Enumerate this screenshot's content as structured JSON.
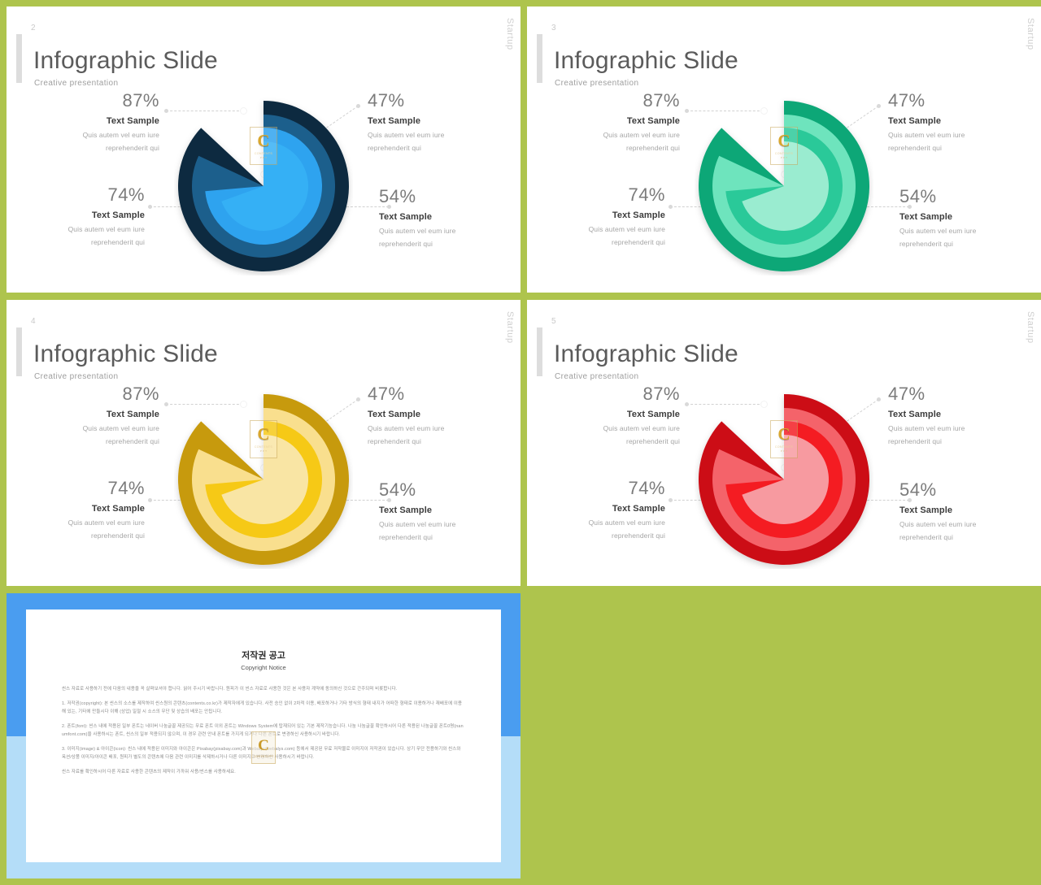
{
  "background_color": "#aec44d",
  "slides": [
    {
      "number": "2",
      "title": "Infographic Slide",
      "subtitle": "Creative  presentation",
      "brand": "Startup",
      "theme": "blue",
      "colors": {
        "ring_outer": "#0e2b40",
        "ring_mid": "#1d5e8c",
        "ring_inner": "#2fa3ef",
        "core": "#35b0f5"
      },
      "labels": [
        {
          "pos": "top-left",
          "percent": "87%",
          "title": "Text Sample",
          "body_line1": "Quis autem  vel eum  iure",
          "body_line2": "reprehenderit   qui"
        },
        {
          "pos": "top-right",
          "percent": "47%",
          "title": "Text Sample",
          "body_line1": "Quis autem  vel eum  iure",
          "body_line2": "reprehenderit   qui"
        },
        {
          "pos": "bottom-left",
          "percent": "74%",
          "title": "Text Sample",
          "body_line1": "Quis autem  vel eum  iure",
          "body_line2": "reprehenderit   qui"
        },
        {
          "pos": "bottom-right",
          "percent": "54%",
          "title": "Text Sample",
          "body_line1": "Quis autem  vel eum  iure",
          "body_line2": "reprehenderit   qui"
        }
      ]
    },
    {
      "number": "3",
      "title": "Infographic Slide",
      "subtitle": "Creative  presentation",
      "brand": "Startup",
      "theme": "green",
      "colors": {
        "ring_outer": "#0fa777",
        "ring_mid": "#6ee4bd",
        "ring_inner": "#2cc999",
        "core": "#9aecd0"
      },
      "labels": [
        {
          "pos": "top-left",
          "percent": "87%",
          "title": "Text Sample",
          "body_line1": "Quis autem  vel eum  iure",
          "body_line2": "reprehenderit   qui"
        },
        {
          "pos": "top-right",
          "percent": "47%",
          "title": "Text Sample",
          "body_line1": "Quis autem  vel eum  iure",
          "body_line2": "reprehenderit   qui"
        },
        {
          "pos": "bottom-left",
          "percent": "74%",
          "title": "Text Sample",
          "body_line1": "Quis autem  vel eum  iure",
          "body_line2": "reprehenderit   qui"
        },
        {
          "pos": "bottom-right",
          "percent": "54%",
          "title": "Text Sample",
          "body_line1": "Quis autem  vel eum  iure",
          "body_line2": "reprehenderit   qui"
        }
      ]
    },
    {
      "number": "4",
      "title": "Infographic Slide",
      "subtitle": "Creative  presentation",
      "brand": "Startup",
      "theme": "gold",
      "colors": {
        "ring_outer": "#c79a10",
        "ring_mid": "#f9df8e",
        "ring_inner": "#f6c913",
        "core": "#f9e5a4"
      },
      "labels": [
        {
          "pos": "top-left",
          "percent": "87%",
          "title": "Text Sample",
          "body_line1": "Quis autem  vel eum  iure",
          "body_line2": "reprehenderit   qui"
        },
        {
          "pos": "top-right",
          "percent": "47%",
          "title": "Text Sample",
          "body_line1": "Quis autem  vel eum  iure",
          "body_line2": "reprehenderit   qui"
        },
        {
          "pos": "bottom-left",
          "percent": "74%",
          "title": "Text Sample",
          "body_line1": "Quis autem  vel eum  iure",
          "body_line2": "reprehenderit   qui"
        },
        {
          "pos": "bottom-right",
          "percent": "54%",
          "title": "Text Sample",
          "body_line1": "Quis autem  vel eum  iure",
          "body_line2": "reprehenderit   qui"
        }
      ]
    },
    {
      "number": "5",
      "title": "Infographic Slide",
      "subtitle": "Creative  presentation",
      "brand": "Startup",
      "theme": "red",
      "colors": {
        "ring_outer": "#cc0b15",
        "ring_mid": "#f4636b",
        "ring_inner": "#f41a23",
        "core": "#f79aa0"
      },
      "labels": [
        {
          "pos": "top-left",
          "percent": "87%",
          "title": "Text Sample",
          "body_line1": "Quis autem  vel eum  iure",
          "body_line2": "reprehenderit   qui"
        },
        {
          "pos": "top-right",
          "percent": "47%",
          "title": "Text Sample",
          "body_line1": "Quis autem  vel eum  iure",
          "body_line2": "reprehenderit   qui"
        },
        {
          "pos": "bottom-left",
          "percent": "74%",
          "title": "Text Sample",
          "body_line1": "Quis autem  vel eum  iure",
          "body_line2": "reprehenderit   qui"
        },
        {
          "pos": "bottom-right",
          "percent": "54%",
          "title": "Text Sample",
          "body_line1": "Quis autem  vel eum  iure",
          "body_line2": "reprehenderit   qui"
        }
      ]
    }
  ],
  "watermark": {
    "letter": "C",
    "line1": "CONTENTS",
    "line2": "P P T"
  },
  "copyright_panel": {
    "frame_top_color": "#4a9df0",
    "frame_bottom_color": "#b4ddf8",
    "title": "저작권 공고",
    "subtitle": "Copyright Notice",
    "paragraphs": [
      "씬스 자료로 사용하기 전에 다음의 내용을 꼭 살펴보셔야 합니다. 읽어 주시기 바랍니다. 원피가 이 씬스 자료로 사용한 것은 본 사용자 계약에 동의하신 것으로 간주되며 비롯합니다.",
      "1. 저작권(copyright): 본 씬스의 소스를 제작하여 씬스원의 콘텐츠(contents.co.kr)가 제작자에게 있습니다. 사전 승인 없이 2차적 이용, 배포하거나 기타 방식의 형태 내지가 어떠한 형태로 이용하거나 재배포에 이용해 있는, 기타에 만들시다 이해 (상업) 일절 시 소스의 무단 및 상습의 배포는 안됩니다.",
      "2. 폰트(font): 씬스 내에 적용된 일부 폰트는 네이버 나눔글꼴 제공되는 무료 폰트 이외 폰트는 Windows System에 탑재되어 있는 기본 제작기능습니다. 나눔 나눔글꼴 확인하시어 다른 적용된 나눔글꼴 폰트0명(nanumfont.com)을 사용하시는 폰트, 씬스의 일부 적용되지 않으며, 이 경우 관련 안내 폰트를 가지게 되거나 다른 폰트로 변경하신 사용하시기 바랍니다.",
      "3. 이미지(image) & 아이콘(icon): 씬스 내에 적용된 이미지와 아이콘은 Pixabay(pixabay.com)과 Webalys(webalys.com) 등에서 제공된 무료 저작물로 이미지이 저작권이 있습니다. 상기 무단 전용하기와 씬스와 옥션/상품 이미지/아이콘 배포, 원피가 별도의 콘텐츠에 다음 관련 이미지를 삭제하시거나 다른 이미지로 변경하신 사용하시기 바랍니다.",
      "씬스 자료를 확인하시어 다른 자료로 사용한 콘텐츠의 제작이 가까워 사용/씬스를 사용하세요."
    ],
    "watermark": {
      "letter": "C",
      "line1": "CONTENTS PPT"
    }
  }
}
